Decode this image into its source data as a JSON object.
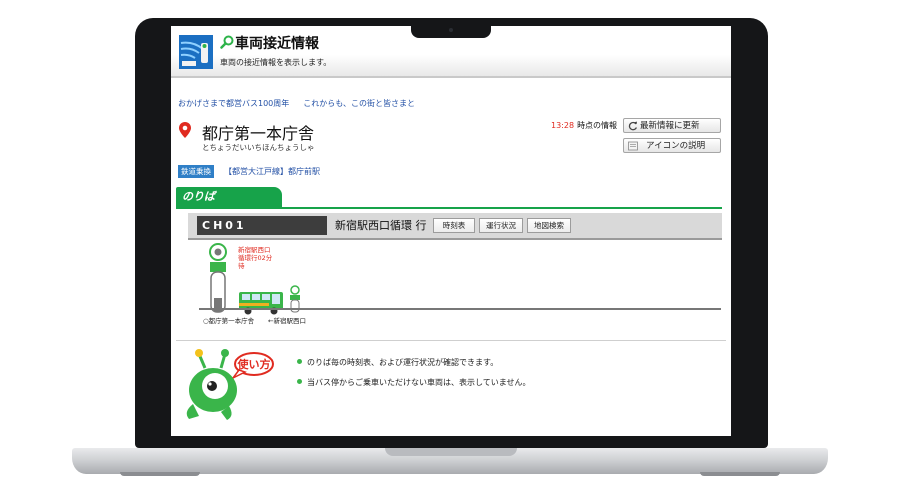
{
  "header": {
    "title": "車両接近情報",
    "subtitle": "車両の接近情報を表示します。"
  },
  "promo": [
    "おかげさまで都営バス100周年",
    "これからも、この街と皆さまと"
  ],
  "stop": {
    "name": "都庁第一本庁舎",
    "kana": "とちょうだいいちほんちょうしゃ"
  },
  "info": {
    "time": "13:28",
    "suffix": "時点の情報",
    "refresh_label": "最新情報に更新",
    "icon_help_label": "アイコンの説明"
  },
  "rail": {
    "tag": "鉄道乗換",
    "link": "【都営大江戸線】都庁前駅"
  },
  "tab_label": "のりば",
  "route": {
    "code": "CH01",
    "destination": "新宿駅西口循環 行",
    "buttons": [
      "時刻表",
      "運行状況",
      "地図検索"
    ]
  },
  "arrival": {
    "line1": "新宿駅西口",
    "line2": "循環行02分",
    "line3": "待"
  },
  "track_labels": {
    "current": "○都庁第一本庁舎",
    "next": "←新宿駅西口"
  },
  "help": {
    "badge": "使い方",
    "items": [
      "のりば毎の時刻表、および運行状況が確認できます。",
      "当バス停からご乗車いただけない車両は、表示していません。"
    ]
  },
  "colors": {
    "accent_green": "#17a34a",
    "alert_red": "#e02b20",
    "link_blue": "#2451a6",
    "rail_tag": "#2f7fc7"
  },
  "icons": [
    "logo-icon",
    "search-icon",
    "location-pin-icon",
    "refresh-icon",
    "info-icon",
    "bus-stop-icon",
    "bus-icon",
    "mascot-icon"
  ]
}
